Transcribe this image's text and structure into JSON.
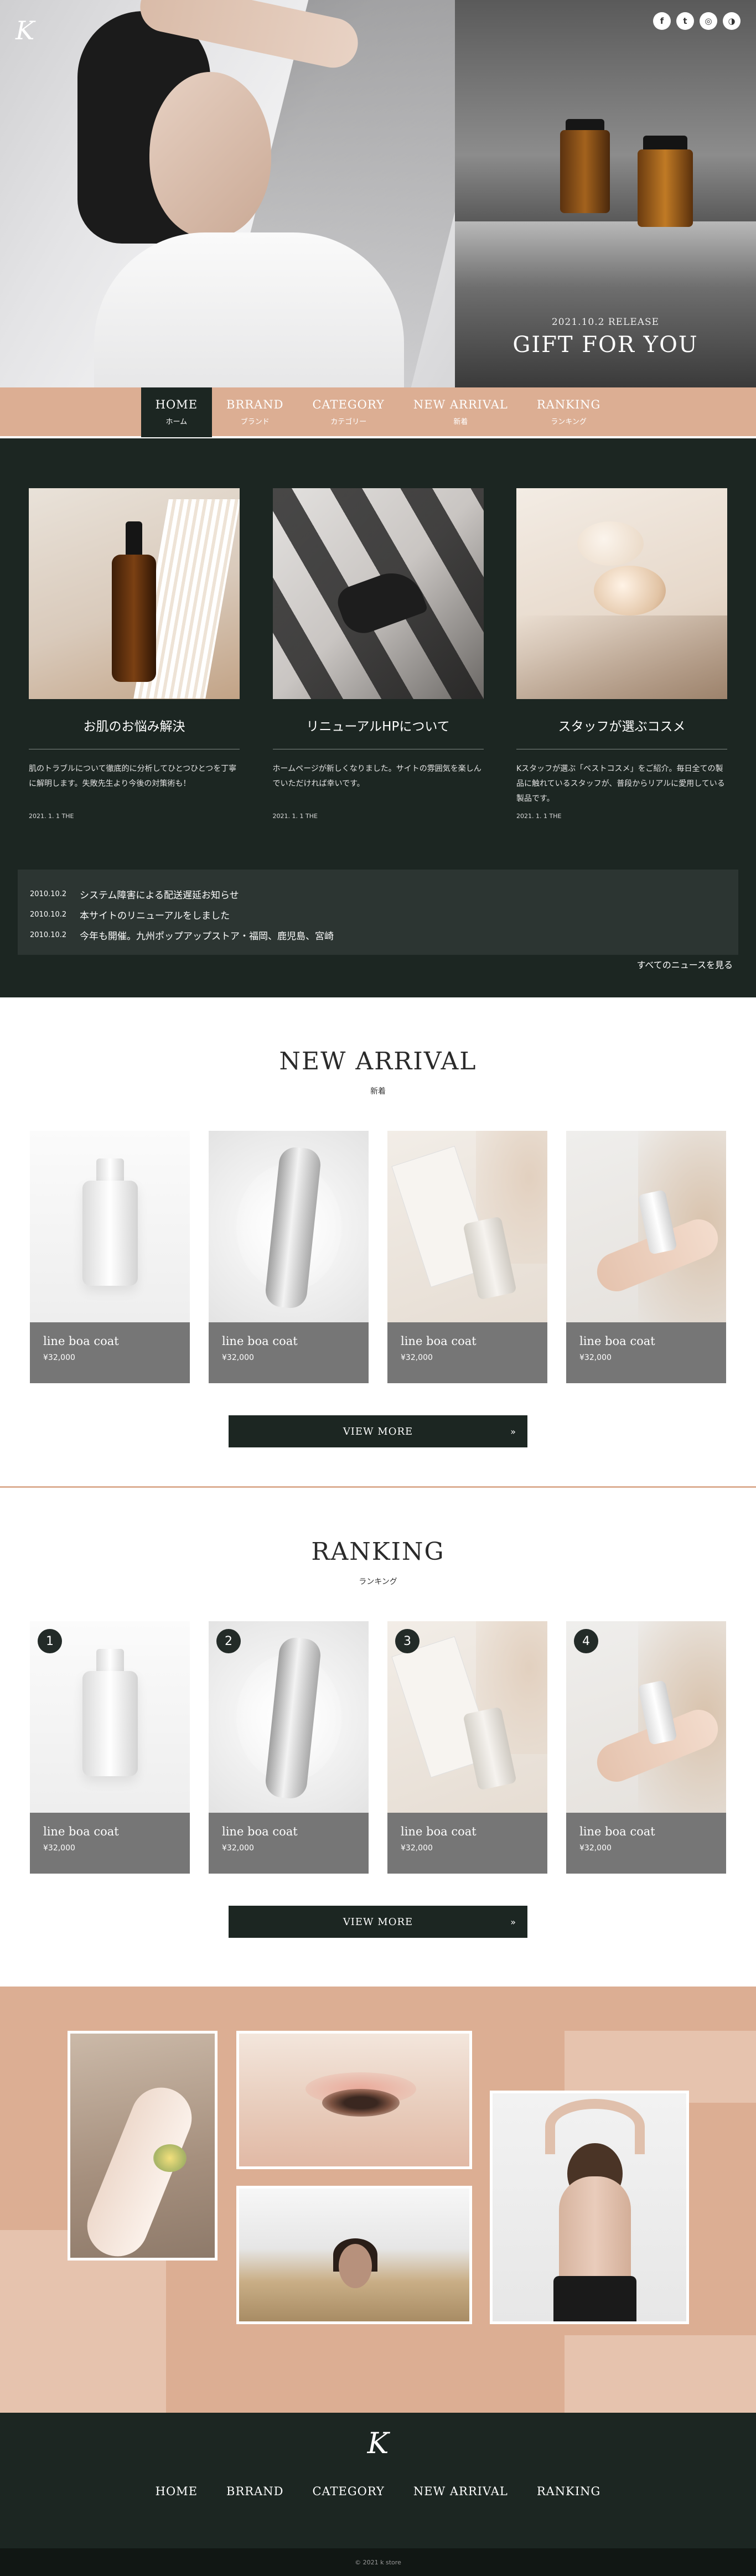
{
  "hero": {
    "logo": "K",
    "release": "2021.10.2 RELEASE",
    "title": "GIFT FOR YOU",
    "social": [
      "f",
      "t",
      "◎",
      "◑"
    ]
  },
  "nav": [
    {
      "en": "HOME",
      "jp": "ホーム",
      "active": true
    },
    {
      "en": "BRRAND",
      "jp": "ブランド"
    },
    {
      "en": "CATEGORY",
      "jp": "カテゴリー"
    },
    {
      "en": "NEW ARRIVAL",
      "jp": "新着"
    },
    {
      "en": "RANKING",
      "jp": "ランキング"
    }
  ],
  "features": [
    {
      "title": "お肌のお悩み解決",
      "text": "肌のトラブルについて徹底的に分析してひとつひとつを丁寧に解明します。失敗先生より今後の対策術も！",
      "date": "2021. 1. 1 THE"
    },
    {
      "title": "リニューアルHPについて",
      "text": "ホームページが新しくなりました。サイトの雰囲気を楽しんでいただければ幸いです。",
      "date": "2021. 1. 1 THE"
    },
    {
      "title": "スタッフが選ぶコスメ",
      "text": "Kスタッフが選ぶ「ベストコスメ」をご紹介。毎日全ての製品に触れているスタッフが、普段からリアルに愛用している製品です。",
      "date": "2021. 1. 1 THE"
    }
  ],
  "news": [
    {
      "date": "2010.10.2",
      "text": "システム障害による配送遅延お知らせ"
    },
    {
      "date": "2010.10.2",
      "text": "本サイトのリニューアルをしました"
    },
    {
      "date": "2010.10.2",
      "text": "今年も開催。九州ポップアップストア・福岡、鹿児島、宮崎"
    }
  ],
  "news_all": "すべてのニュースを見る",
  "new_arrival": {
    "title": "NEW ARRIVAL",
    "sub": "新着",
    "products": [
      {
        "name": "line boa coat",
        "price": "¥32,000"
      },
      {
        "name": "line boa coat",
        "price": "¥32,000"
      },
      {
        "name": "line boa coat",
        "price": "¥32,000"
      },
      {
        "name": "line boa coat",
        "price": "¥32,000"
      }
    ],
    "view_more": "VIEW MORE",
    "arrow": "»"
  },
  "ranking": {
    "title": "RANKING",
    "sub": "ランキング",
    "products": [
      {
        "rank": "1",
        "name": "line boa coat",
        "price": "¥32,000"
      },
      {
        "rank": "2",
        "name": "line boa coat",
        "price": "¥32,000"
      },
      {
        "rank": "3",
        "name": "line boa coat",
        "price": "¥32,000"
      },
      {
        "rank": "4",
        "name": "line boa coat",
        "price": "¥32,000"
      }
    ],
    "view_more": "VIEW MORE",
    "arrow": "»"
  },
  "footer": {
    "logo": "K",
    "nav": [
      "HOME",
      "BRRAND",
      "CATEGORY",
      "NEW ARRIVAL",
      "RANKING"
    ],
    "copyright": "© 2021 k store"
  },
  "colors": {
    "dark": "#1c2622",
    "accent": "#dcae93",
    "product_info": "#767676"
  }
}
